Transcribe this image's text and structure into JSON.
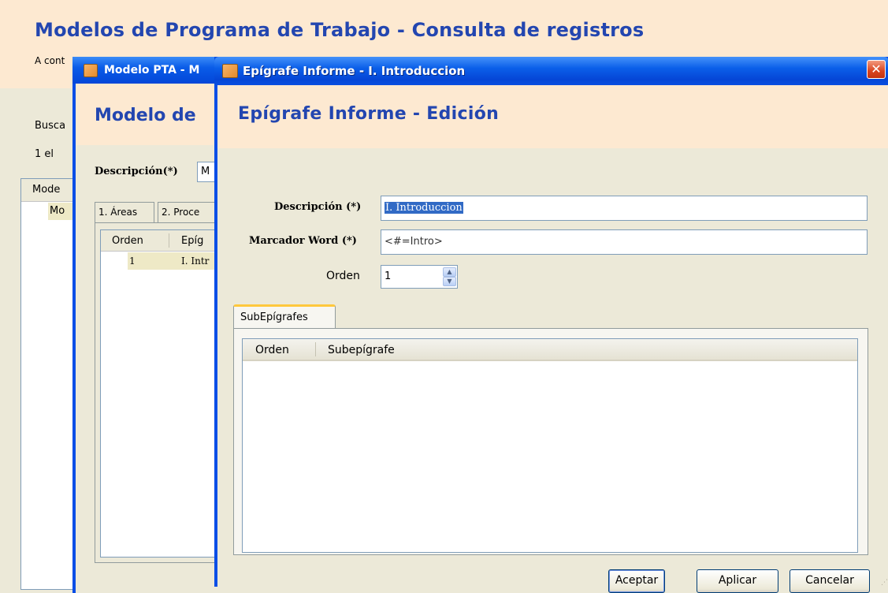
{
  "background": {
    "title": "Modelos de Programa de Trabajo - Consulta de registros",
    "intro_text": "A cont",
    "search_label": "Busca",
    "result_count": "1  el",
    "column_header": "Mode",
    "row_text": "Mo"
  },
  "modelo_window": {
    "title": "Modelo PTA - M",
    "heading": "Modelo de",
    "description_label": "Descripción(*)",
    "description_value": "M",
    "tabs": [
      {
        "label": "1. Áreas"
      },
      {
        "label": "2. Proce"
      }
    ],
    "table": {
      "headers": [
        "Orden",
        "Epíg"
      ],
      "rows": [
        {
          "orden": "1",
          "epigrafe": "I. Intr"
        }
      ]
    }
  },
  "epigrafe_window": {
    "title": "Epígrafe Informe - I. Introduccion",
    "close_glyph": "✕",
    "heading": "Epígrafe Informe - Edición",
    "fields": {
      "description_label": "Descripción (*)",
      "description_value": "I. Introduccion",
      "marker_label": "Marcador Word (*)",
      "marker_value": "<#=Intro>",
      "order_label": "Orden",
      "order_value": "1"
    },
    "spinner": {
      "up_glyph": "▲",
      "down_glyph": "▼"
    },
    "subtab_label": "SubEpígrafes",
    "subtable_headers": [
      "Orden",
      "Subepígrafe"
    ],
    "buttons": {
      "accept": "Aceptar",
      "apply": "Aplicar",
      "cancel": "Cancelar"
    },
    "resize_glyph": "⋰"
  }
}
